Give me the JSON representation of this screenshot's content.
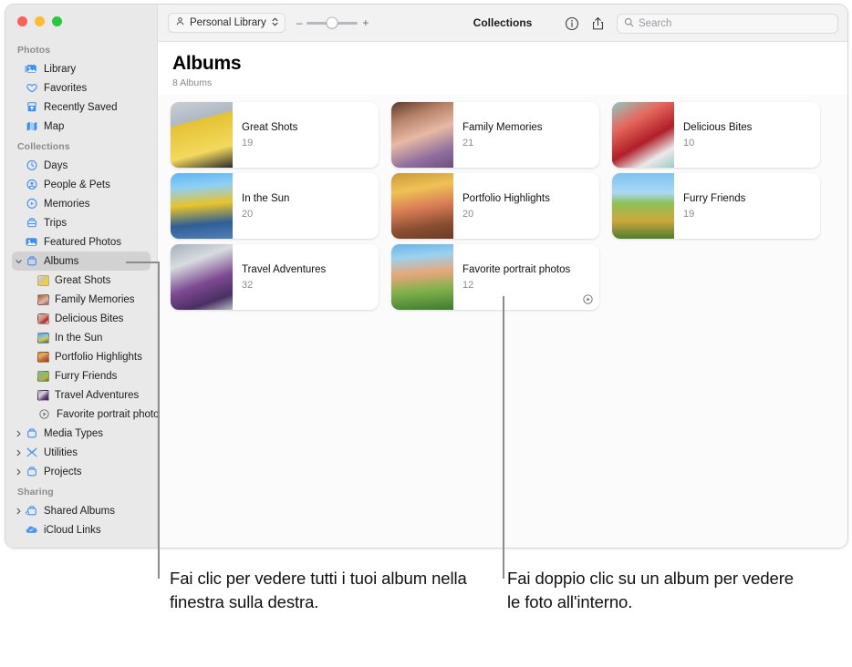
{
  "window": {
    "traffic_lights": [
      "close",
      "minimize",
      "zoom"
    ],
    "toolbar": {
      "library_popup_label": "Personal Library",
      "library_popup_icon": "person-icon",
      "zoom_out_label": "–",
      "zoom_in_label": "+",
      "zoom_slider_value": 50,
      "title": "Collections",
      "info_icon": "info-circle-icon",
      "share_icon": "share-icon",
      "search_placeholder": "Search",
      "search_value": "",
      "search_icon": "search-icon"
    }
  },
  "sidebar": {
    "sections": [
      {
        "title": "Photos",
        "items": [
          {
            "label": "Library",
            "icon": "library-icon",
            "kind": "icon",
            "selected": false,
            "expandable": false
          },
          {
            "label": "Favorites",
            "icon": "heart-icon",
            "kind": "icon",
            "selected": false,
            "expandable": false
          },
          {
            "label": "Recently Saved",
            "icon": "recently-saved-icon",
            "kind": "icon",
            "selected": false,
            "expandable": false
          },
          {
            "label": "Map",
            "icon": "map-icon",
            "kind": "icon",
            "selected": false,
            "expandable": false
          }
        ]
      },
      {
        "title": "Collections",
        "items": [
          {
            "label": "Days",
            "icon": "clock-icon",
            "kind": "icon",
            "selected": false,
            "expandable": false
          },
          {
            "label": "People & Pets",
            "icon": "person-circle-icon",
            "kind": "icon",
            "selected": false,
            "expandable": false
          },
          {
            "label": "Memories",
            "icon": "memories-icon",
            "kind": "icon",
            "selected": false,
            "expandable": false
          },
          {
            "label": "Trips",
            "icon": "trips-icon",
            "kind": "icon",
            "selected": false,
            "expandable": false
          },
          {
            "label": "Featured Photos",
            "icon": "featured-photos-icon",
            "kind": "icon",
            "selected": false,
            "expandable": false
          },
          {
            "label": "Albums",
            "icon": "albums-icon",
            "kind": "icon",
            "selected": true,
            "expandable": true,
            "expanded": true
          },
          {
            "label": "Great Shots",
            "icon": "album-thumb-great-shots",
            "kind": "thumb",
            "thumb": "tg1",
            "child": true
          },
          {
            "label": "Family Memories",
            "icon": "album-thumb-family-memories",
            "kind": "thumb",
            "thumb": "tg2",
            "child": true
          },
          {
            "label": "Delicious Bites",
            "icon": "album-thumb-delicious-bites",
            "kind": "thumb",
            "thumb": "tg3",
            "child": true
          },
          {
            "label": "In the Sun",
            "icon": "album-thumb-in-the-sun",
            "kind": "thumb",
            "thumb": "tg4",
            "child": true
          },
          {
            "label": "Portfolio Highlights",
            "icon": "album-thumb-portfolio",
            "kind": "thumb",
            "thumb": "tg5",
            "child": true
          },
          {
            "label": "Furry Friends",
            "icon": "album-thumb-furry-friends",
            "kind": "thumb",
            "thumb": "tg6",
            "child": true
          },
          {
            "label": "Travel Adventures",
            "icon": "album-thumb-travel-adventures",
            "kind": "thumb",
            "thumb": "tg7",
            "child": true
          },
          {
            "label": "Favorite portrait photos",
            "icon": "smart-album-icon",
            "kind": "smart",
            "child": true
          },
          {
            "label": "Media Types",
            "icon": "media-types-icon",
            "kind": "icon",
            "selected": false,
            "expandable": true,
            "expanded": false
          },
          {
            "label": "Utilities",
            "icon": "utilities-icon",
            "kind": "icon",
            "selected": false,
            "expandable": true,
            "expanded": false
          },
          {
            "label": "Projects",
            "icon": "projects-icon",
            "kind": "icon",
            "selected": false,
            "expandable": true,
            "expanded": false
          }
        ]
      },
      {
        "title": "Sharing",
        "items": [
          {
            "label": "Shared Albums",
            "icon": "shared-albums-icon",
            "kind": "icon",
            "selected": false,
            "expandable": true,
            "expanded": false
          },
          {
            "label": "iCloud Links",
            "icon": "icloud-links-icon",
            "kind": "icon",
            "selected": false,
            "expandable": false
          }
        ]
      }
    ]
  },
  "main": {
    "heading": "Albums",
    "subheading": "8 Albums",
    "albums": [
      {
        "name": "Great Shots",
        "count": "19",
        "cover": "c1",
        "smart": false
      },
      {
        "name": "Family Memories",
        "count": "21",
        "cover": "c2",
        "smart": false
      },
      {
        "name": "Delicious Bites",
        "count": "10",
        "cover": "c3",
        "smart": false
      },
      {
        "name": "In the Sun",
        "count": "20",
        "cover": "c4",
        "smart": false
      },
      {
        "name": "Portfolio Highlights",
        "count": "20",
        "cover": "c5",
        "smart": false
      },
      {
        "name": "Furry Friends",
        "count": "19",
        "cover": "c6",
        "smart": false
      },
      {
        "name": "Travel Adventures",
        "count": "32",
        "cover": "c7",
        "smart": false
      },
      {
        "name": "Favorite portrait photos",
        "count": "12",
        "cover": "c8",
        "smart": true,
        "smart_icon": "smart-album-icon"
      }
    ]
  },
  "callouts": [
    {
      "text": "Fai clic per vedere tutti i tuoi album nella finestra sulla destra."
    },
    {
      "text": "Fai doppio clic su un album per vedere le foto all'interno."
    }
  ]
}
